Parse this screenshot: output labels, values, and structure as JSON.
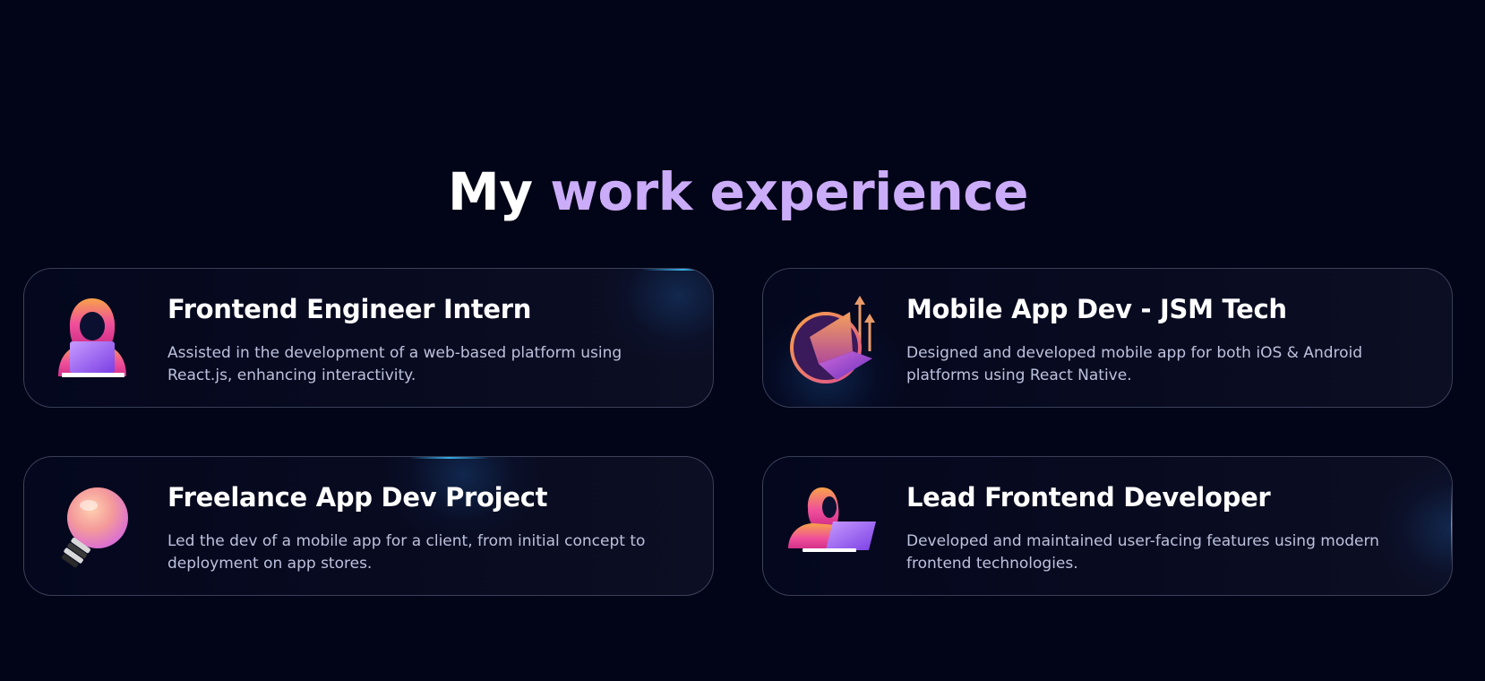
{
  "heading": {
    "prefix": "My",
    "accent": "work experience"
  },
  "colors": {
    "background": "#020417",
    "accent": "#cbacf9",
    "card_border": "#4a5068",
    "description": "#bec1dd",
    "glow": "#38bdf8"
  },
  "experiences": [
    {
      "title": "Frontend Engineer Intern",
      "description": "Assisted in the development of a web-based platform using React.js, enhancing interactivity.",
      "icon": "hooded-coder-laptop-icon"
    },
    {
      "title": "Mobile App Dev - JSM Tech",
      "description": "Designed and developed mobile app for both iOS & Android platforms using React Native.",
      "icon": "growth-arrows-laptop-icon"
    },
    {
      "title": "Freelance App Dev Project",
      "description": "Led the dev of a mobile app for a client, from initial concept to deployment on app stores.",
      "icon": "lightbulb-icon"
    },
    {
      "title": "Lead Frontend Developer",
      "description": "Developed and maintained user-facing features using modern frontend technologies.",
      "icon": "hooded-developer-laptop-icon"
    }
  ]
}
